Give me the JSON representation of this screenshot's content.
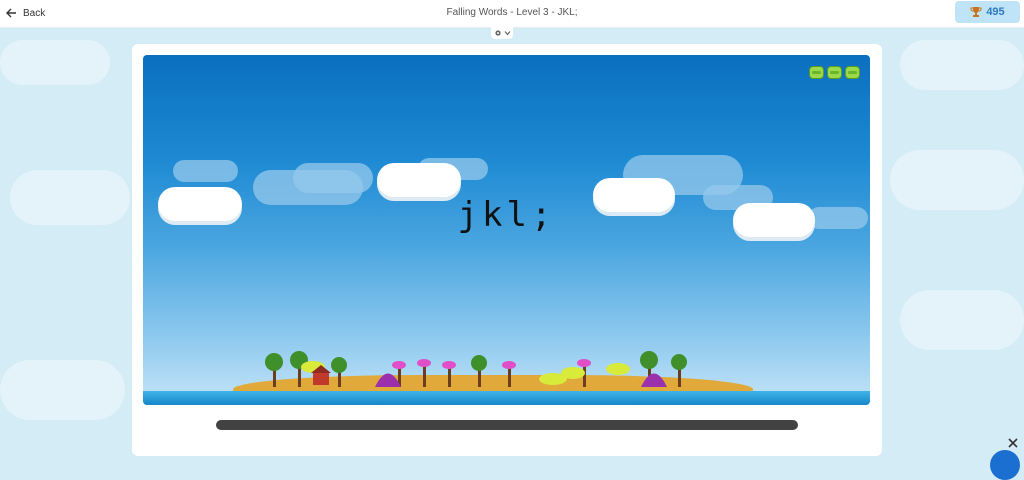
{
  "header": {
    "back_label": "Back",
    "title": "Falling Words - Level 3 - JKL;",
    "score": "495"
  },
  "game": {
    "current_word": "jkl;",
    "lives_remaining": 3
  },
  "progress": {
    "fraction": 0.0
  },
  "icons": {
    "back": "arrow-left-icon",
    "trophy": "trophy-icon",
    "settings": "gear-icon",
    "close": "close-icon",
    "chat": "chat-icon"
  },
  "colors": {
    "accent": "#2b7bbf",
    "sky_top": "#0a6fbf",
    "progress_track": "#424242"
  }
}
